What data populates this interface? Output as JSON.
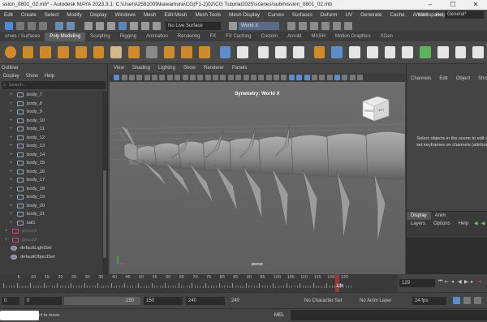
{
  "titlebar": {
    "title": "ssion_0801_02.mb* - Autodesk MAYA 2023.3.1: C:\\Users\\2581009\\kawamura\\CG(F1-2)02\\CG Tutorial2025\\scenes\\submission_0801_02.mb"
  },
  "menubar": {
    "items": [
      "Edit",
      "Create",
      "Select",
      "Modify",
      "Display",
      "Windows",
      "Mesh",
      "Edit Mesh",
      "Mesh Tools",
      "Mesh Display",
      "Curves",
      "Surfaces",
      "Deform",
      "UV",
      "Generate",
      "Cache",
      "Arnold",
      "Help"
    ],
    "workspace_label": "Workspace:",
    "workspace_value": "General*"
  },
  "statusline": {
    "live_surface": "No Live Surface",
    "world": "World X"
  },
  "shelf_tabs": [
    "urves / Surfaces",
    "Poly Modeling",
    "Sculpting",
    "Rigging",
    "Animation",
    "Rendering",
    "FX",
    "FX Caching",
    "Custom",
    "Arnold",
    "MASH",
    "Motion Graphics",
    "XGen"
  ],
  "outliner": {
    "title": "Outliner",
    "menu": [
      "Display",
      "Show",
      "Help"
    ],
    "search_placeholder": "Search...",
    "items": [
      {
        "label": "body_7",
        "kind": "mesh"
      },
      {
        "label": "body_8",
        "kind": "mesh"
      },
      {
        "label": "body_9",
        "kind": "mesh"
      },
      {
        "label": "body_10",
        "kind": "mesh"
      },
      {
        "label": "body_11",
        "kind": "mesh"
      },
      {
        "label": "body_12",
        "kind": "mesh"
      },
      {
        "label": "body_13",
        "kind": "mesh"
      },
      {
        "label": "body_14",
        "kind": "mesh"
      },
      {
        "label": "body_15",
        "kind": "mesh"
      },
      {
        "label": "body_16",
        "kind": "mesh"
      },
      {
        "label": "body_17",
        "kind": "mesh"
      },
      {
        "label": "body_18",
        "kind": "mesh"
      },
      {
        "label": "body_19",
        "kind": "mesh"
      },
      {
        "label": "body_20",
        "kind": "mesh"
      },
      {
        "label": "body_21",
        "kind": "mesh"
      },
      {
        "label": "tail1",
        "kind": "mesh"
      },
      {
        "label": "group2",
        "kind": "group"
      },
      {
        "label": "group3",
        "kind": "group"
      },
      {
        "label": "defaultLightSet",
        "kind": "set"
      },
      {
        "label": "defaultObjectSet",
        "kind": "set"
      }
    ]
  },
  "viewport": {
    "menu": [
      "View",
      "Shading",
      "Lighting",
      "Show",
      "Renderer",
      "Panels"
    ],
    "symmetry": "Symmetry: World X",
    "camera": "persp",
    "viewcube_front": "FRONT",
    "viewcube_side": "LEFT"
  },
  "channelbox": {
    "tabs": [
      "Channels",
      "Edit",
      "Object",
      "Show"
    ],
    "message": "Select objects in the scene to edit and set keyframes on channels (attributes)",
    "layer_tabs": [
      "Display",
      "Anim"
    ],
    "layer_menu": [
      "Layers",
      "Options",
      "Help"
    ]
  },
  "timeslider": {
    "ticks": [
      "",
      "5",
      "10",
      "15",
      "20",
      "25",
      "30",
      "35",
      "40",
      "45",
      "50",
      "55",
      "60",
      "65",
      "70",
      "75",
      "80",
      "85",
      "90",
      "95",
      "100",
      "105",
      "110",
      "115",
      "120",
      "125"
    ],
    "current_frame": "129",
    "frame_marker": "129"
  },
  "rangeslider": {
    "start": "0",
    "playback_start": "0",
    "range_end": "150",
    "playback_end": "150",
    "anim_end": "240",
    "character_set": "No Character Set",
    "anim_layer": "No Anim Layer",
    "fps": "24 fps"
  },
  "cmdline": {
    "help": "ct to move.",
    "mel_label": "MEL"
  }
}
